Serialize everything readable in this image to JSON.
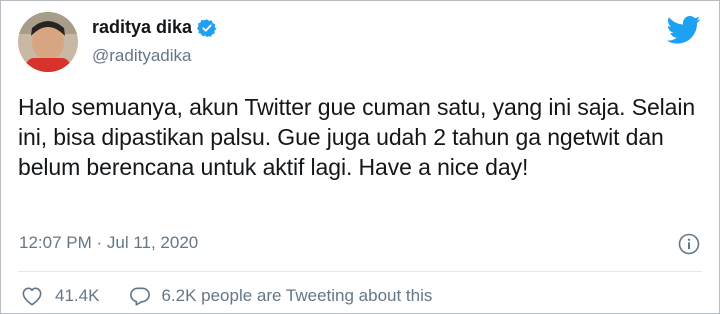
{
  "user": {
    "display_name": "raditya dika",
    "handle": "@radityadika",
    "verified": true
  },
  "tweet": {
    "text": "Halo semuanya, akun Twitter gue cuman satu, yang ini saja. Selain ini, bisa dipastikan palsu. Gue juga udah 2 tahun ga ngetwit dan belum berencana untuk aktif lagi. Have a nice day!",
    "timestamp": "12:07 PM · Jul 11, 2020"
  },
  "actions": {
    "likes": "41.4K",
    "tweeting_text": "6.2K people are Tweeting about this"
  },
  "icons": {
    "brand": "twitter-bird-icon",
    "verified": "verified-badge-icon",
    "info": "info-icon",
    "like": "heart-icon",
    "comment": "comment-icon"
  },
  "colors": {
    "brand": "#1da1f2",
    "secondary_text": "#657786",
    "primary_text": "#14171a"
  }
}
